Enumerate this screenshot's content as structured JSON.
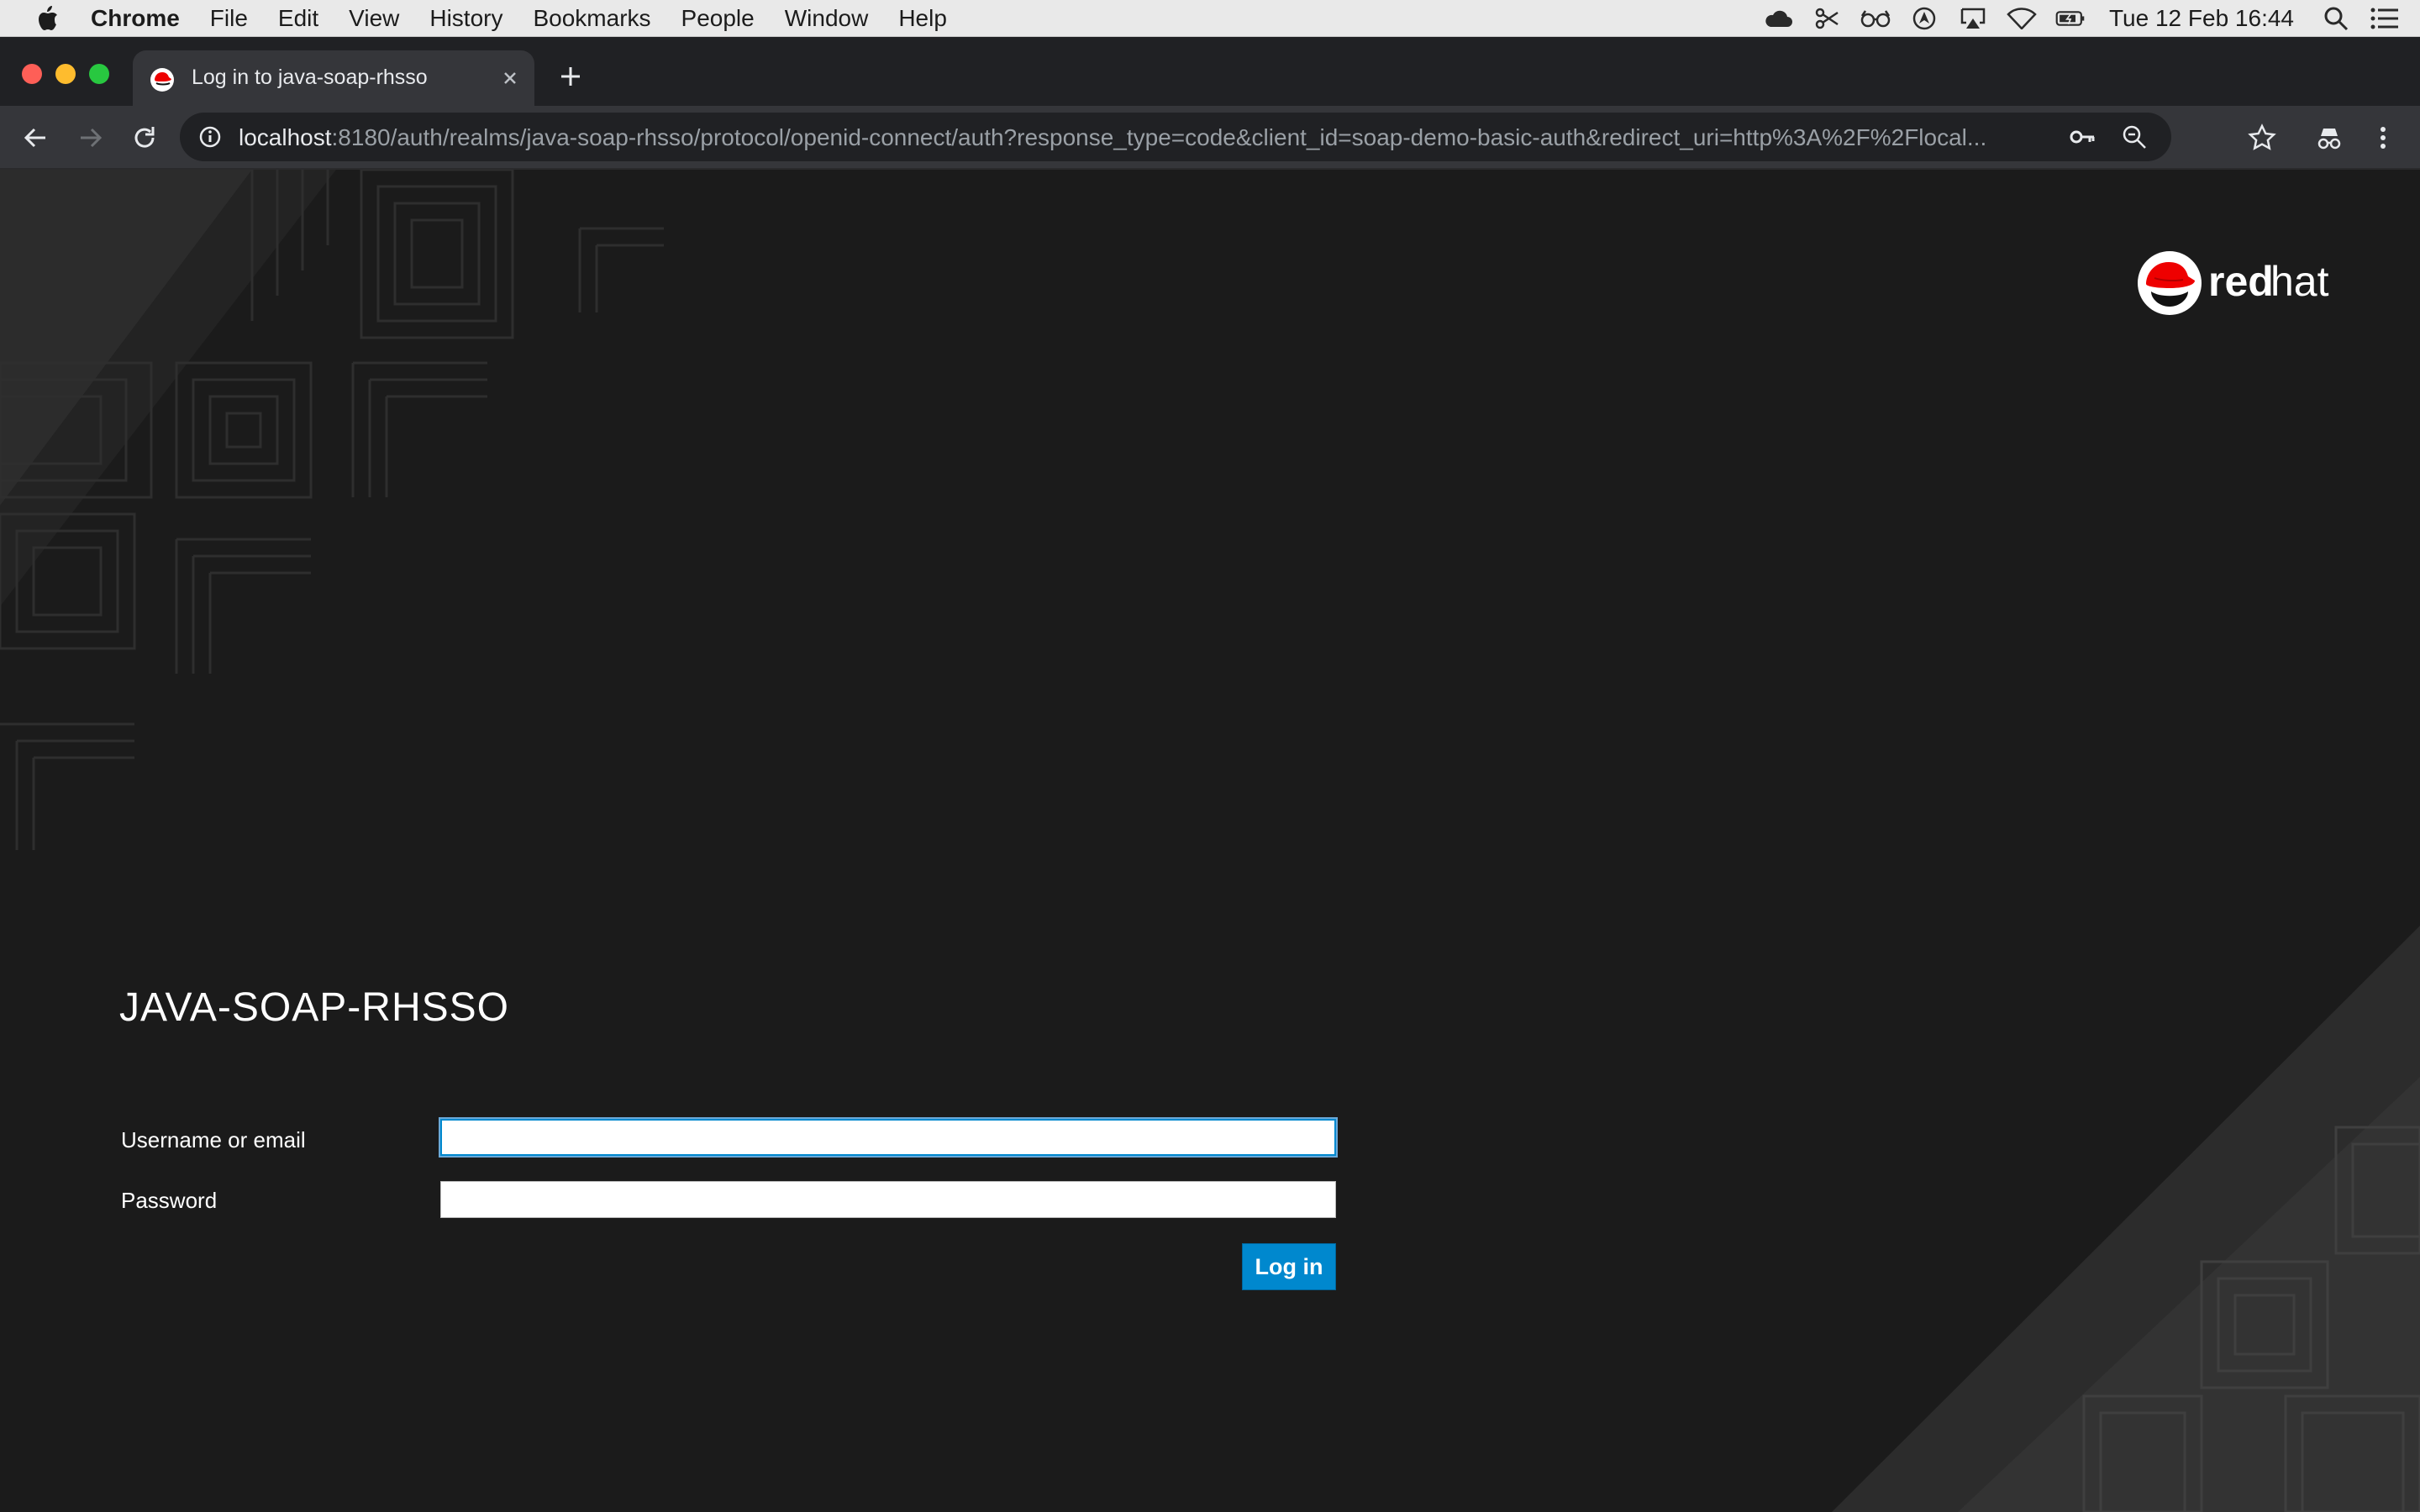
{
  "menubar": {
    "app_name": "Chrome",
    "menus": [
      "File",
      "Edit",
      "View",
      "History",
      "Bookmarks",
      "People",
      "Window",
      "Help"
    ],
    "clock": "Tue 12 Feb  16:44"
  },
  "browser": {
    "tab_title": "Log in to java-soap-rhsso",
    "url_host": "localhost",
    "url_rest": ":8180/auth/realms/java-soap-rhsso/protocol/openid-connect/auth?response_type=code&client_id=soap-demo-basic-auth&redirect_uri=http%3A%2F%2Flocal..."
  },
  "login": {
    "realm_title": "JAVA-SOAP-RHSSO",
    "username_label": "Username or email",
    "username_value": "",
    "password_label": "Password",
    "password_value": "",
    "submit_label": "Log in"
  },
  "brand": {
    "logo_text_bold": "red",
    "logo_text_light": "hat",
    "accent_color": "#0088ce",
    "brand_red": "#ee0000"
  }
}
